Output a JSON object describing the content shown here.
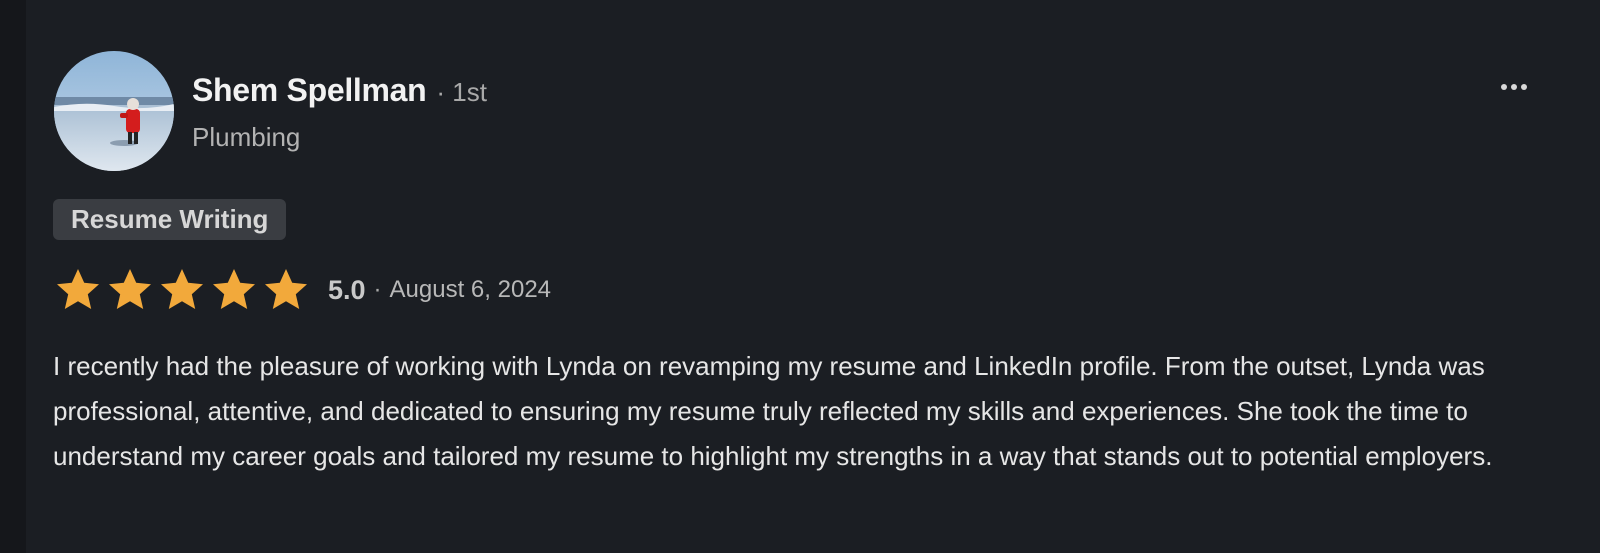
{
  "reviewer": {
    "name": "Shem Spellman",
    "connection_degree": "· 1st",
    "headline": "Plumbing",
    "avatar_icon": "person-on-beach-photo"
  },
  "service_tag": "Resume Writing",
  "rating": {
    "stars_filled": 5,
    "stars_total": 5,
    "score": "5.0",
    "separator": "·",
    "date": "August 6, 2024",
    "star_color": "#f2a93b"
  },
  "review_text": "I recently had the pleasure of working with Lynda on revamping my resume and LinkedIn profile. From the outset, Lynda was professional, attentive, and dedicated to ensuring my resume truly reflected my skills and experiences. She took the time to understand my career goals and tailored my resume to highlight my strengths in a way that stands out to potential employers.",
  "actions": {
    "more_icon": "more-options-icon"
  },
  "colors": {
    "background": "#1b1e23",
    "tag_background": "#3a3d42"
  }
}
